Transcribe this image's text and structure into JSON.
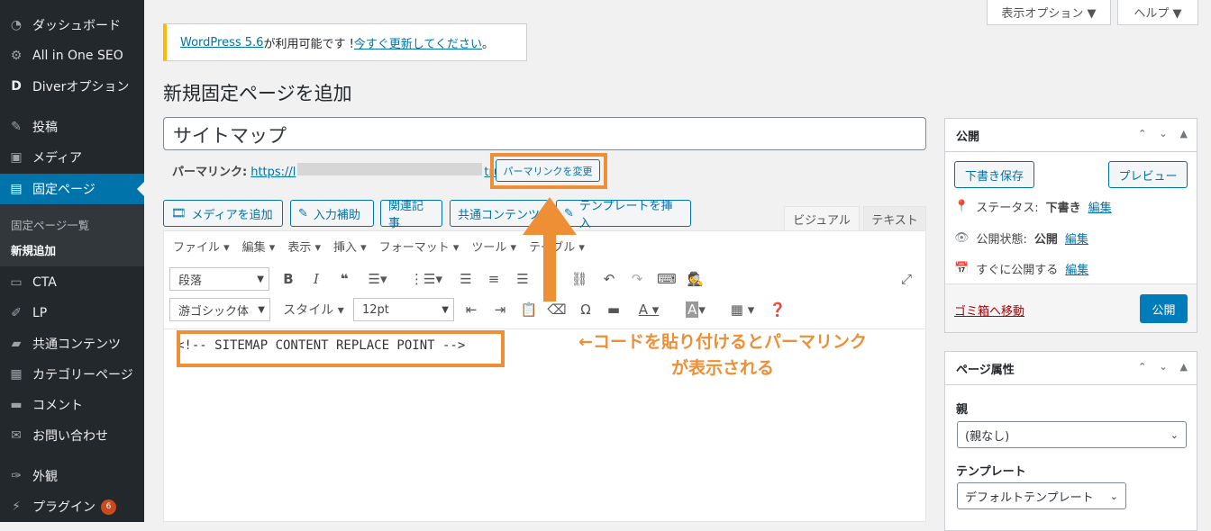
{
  "sidebar": {
    "items": [
      {
        "icon": "dashboard-icon",
        "label": "ダッシュボード"
      },
      {
        "icon": "gear-icon",
        "label": "All in One SEO"
      },
      {
        "icon": "diver-icon",
        "label": "Diverオプション"
      },
      {
        "icon": "pin-icon",
        "label": "投稿"
      },
      {
        "icon": "media-icon",
        "label": "メディア"
      },
      {
        "icon": "page-icon",
        "label": "固定ページ"
      },
      {
        "icon": "cta-icon",
        "label": "CTA"
      },
      {
        "icon": "lp-icon",
        "label": "LP"
      },
      {
        "icon": "folder-icon",
        "label": "共通コンテンツ"
      },
      {
        "icon": "category-icon",
        "label": "カテゴリーページ"
      },
      {
        "icon": "comment-icon",
        "label": "コメント"
      },
      {
        "icon": "mail-icon",
        "label": "お問い合わせ"
      },
      {
        "icon": "brush-icon",
        "label": "外観"
      },
      {
        "icon": "plugin-icon",
        "label": "プラグイン"
      }
    ],
    "submenu": [
      "固定ページ一覧",
      "新規追加"
    ],
    "plugin_badge": "6"
  },
  "top": {
    "screen_options": "表示オプション ▼",
    "help": "ヘルプ ▼"
  },
  "notice": {
    "link1": "WordPress 5.6",
    "text": " が利用可能です ! ",
    "link2": "今すぐ更新してください",
    "end": "。"
  },
  "page": {
    "title": "新規固定ページを追加"
  },
  "post": {
    "title_value": "サイトマップ"
  },
  "permalink": {
    "label": "パーマリンク:",
    "url_start": "https://l",
    "url_end": "true",
    "change_button": "パーマリンクを変更"
  },
  "editor": {
    "buttons": [
      "メディアを追加",
      "入力補助",
      "関連記事",
      "共通コンテンツ",
      "テンプレートを挿入"
    ],
    "tabs": [
      "ビジュアル",
      "テキスト"
    ],
    "menu": [
      "ファイル ▾",
      "編集 ▾",
      "表示 ▾",
      "挿入 ▾",
      "フォーマット ▾",
      "ツール ▾",
      "テーブル ▾"
    ],
    "format_select": "段落",
    "font_select": "游ゴシック体",
    "style_menu": "スタイル ▾",
    "size_select": "12pt",
    "content": "<!-- SITEMAP CONTENT REPLACE POINT -->"
  },
  "annotation": {
    "line1": "←コードを貼り付けるとパーマリンク",
    "line2": "が表示される",
    "color": "#ef8f35"
  },
  "publish": {
    "title": "公開",
    "save_draft": "下書き保存",
    "preview": "プレビュー",
    "status_label": "ステータス:",
    "status_value": "下書き",
    "visibility_label": "公開状態:",
    "visibility_value": "公開",
    "schedule": "すぐに公開する",
    "edit": "編集",
    "trash": "ゴミ箱へ移動",
    "publish_button": "公開"
  },
  "attributes": {
    "title": "ページ属性",
    "parent_label": "親",
    "parent_value": "(親なし)",
    "template_label": "テンプレート",
    "template_value": "デフォルトテンプレート"
  },
  "colors": {
    "accent": "#0073aa",
    "sidebar": "#23282d",
    "highlight": "#ef8f35"
  }
}
